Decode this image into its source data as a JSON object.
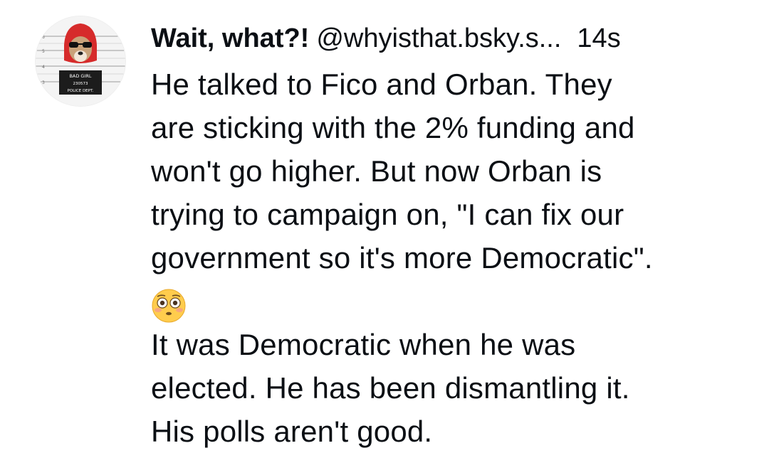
{
  "post": {
    "display_name": "Wait, what?!",
    "handle": "@whyisthat.bsky.s...",
    "timestamp": "14s",
    "avatar": {
      "icon": "mugshot-dog-avatar",
      "placard_line1": "BAD GIRL",
      "placard_line2": "230573",
      "placard_line3": "POLICE DEPT."
    },
    "lines": [
      "He talked to Fico and Orban. They",
      "are sticking with the 2% funding and",
      "won't go higher. But now Orban is",
      "trying to campaign on, \"I can fix our",
      "government so it's more Democratic\"."
    ],
    "emoji": "flushed-face-icon",
    "lines_after": [
      "It was Democratic when he was",
      "elected. He has been dismantling it.",
      "His polls aren't good."
    ]
  },
  "colors": {
    "text": "#0b0f14",
    "background": "#ffffff",
    "hood": "#d62b2b",
    "emoji_face": "#ffcc4d"
  }
}
